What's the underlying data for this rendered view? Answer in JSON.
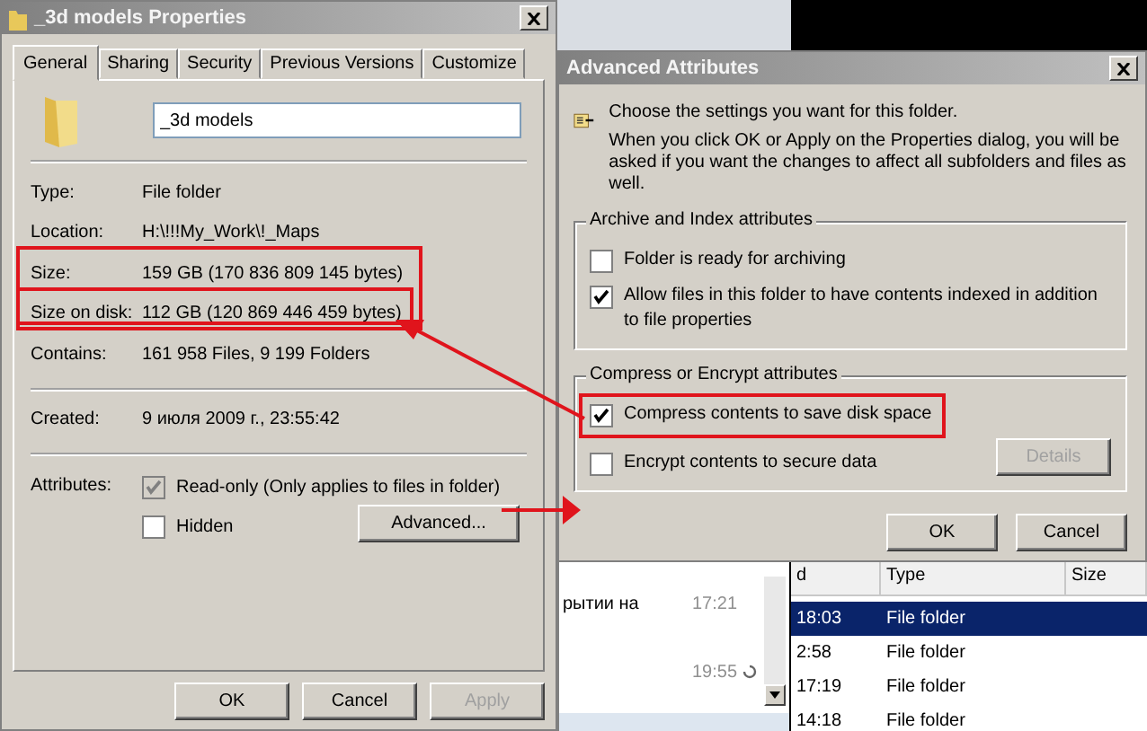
{
  "properties_dialog": {
    "title": "_3d models Properties",
    "tabs": [
      {
        "label": "General",
        "selected": true
      },
      {
        "label": "Sharing",
        "selected": false
      },
      {
        "label": "Security",
        "selected": false
      },
      {
        "label": "Previous Versions",
        "selected": false
      },
      {
        "label": "Customize",
        "selected": false
      }
    ],
    "name_field": {
      "value": "_3d models"
    },
    "sections": [
      [
        {
          "label": "Type:",
          "value": "File folder"
        },
        {
          "label": "Location:",
          "value": "H:\\!!!My_Work\\!_Maps"
        },
        {
          "label": "Size:",
          "value": "159 GB (170 836 809 145 bytes)"
        },
        {
          "label": "Size on disk:",
          "value": "112 GB (120 869 446 459 bytes)"
        },
        {
          "label": "Contains:",
          "value": "161 958 Files, 9 199 Folders"
        }
      ],
      [
        {
          "label": "Created:",
          "value": "9 июля 2009 г., 23:55:42"
        }
      ]
    ],
    "attributes": {
      "label": "Attributes:",
      "options": [
        {
          "label": "Read-only (Only applies to files in folder)",
          "checked": true,
          "disabled": true
        },
        {
          "label": "Hidden",
          "checked": false,
          "disabled": false
        }
      ],
      "advanced_button": "Advanced..."
    },
    "buttons": [
      {
        "label": "OK",
        "disabled": false
      },
      {
        "label": "Cancel",
        "disabled": false
      },
      {
        "label": "Apply",
        "disabled": true
      }
    ]
  },
  "advanced_dialog": {
    "title": "Advanced Attributes",
    "intro": "Choose the settings you want for this folder.",
    "note": "When you click OK or Apply on the Properties dialog, you will be asked if you want the changes to affect all subfolders and files as well.",
    "groups": [
      {
        "title": "Archive and Index attributes",
        "options": [
          {
            "label": "Folder is ready for archiving",
            "checked": false
          },
          {
            "label": "Allow files in this folder to have contents indexed in addition to file properties",
            "checked": true
          }
        ]
      },
      {
        "title": "Compress or Encrypt attributes",
        "options": [
          {
            "label": "Compress contents to save disk space",
            "checked": true
          },
          {
            "label": "Encrypt contents to secure data",
            "checked": false
          }
        ],
        "button": {
          "label": "Details",
          "disabled": true
        }
      }
    ],
    "buttons": [
      {
        "label": "OK",
        "disabled": false
      },
      {
        "label": "Cancel",
        "disabled": false
      }
    ]
  },
  "chat": {
    "items": [
      {
        "text": "рытии на",
        "time": "17:21"
      },
      {
        "time": "19:55"
      }
    ]
  },
  "file_list": {
    "columns": [
      "d",
      "Type",
      "Size"
    ],
    "rows": [
      {
        "cells": [
          "18:03",
          "File folder"
        ],
        "selected": true
      },
      {
        "cells": [
          "2:58",
          "File folder"
        ],
        "selected": false
      },
      {
        "cells": [
          "17:19",
          "File folder"
        ],
        "selected": false
      },
      {
        "cells": [
          "14:18",
          "File folder"
        ],
        "selected": false
      }
    ]
  }
}
